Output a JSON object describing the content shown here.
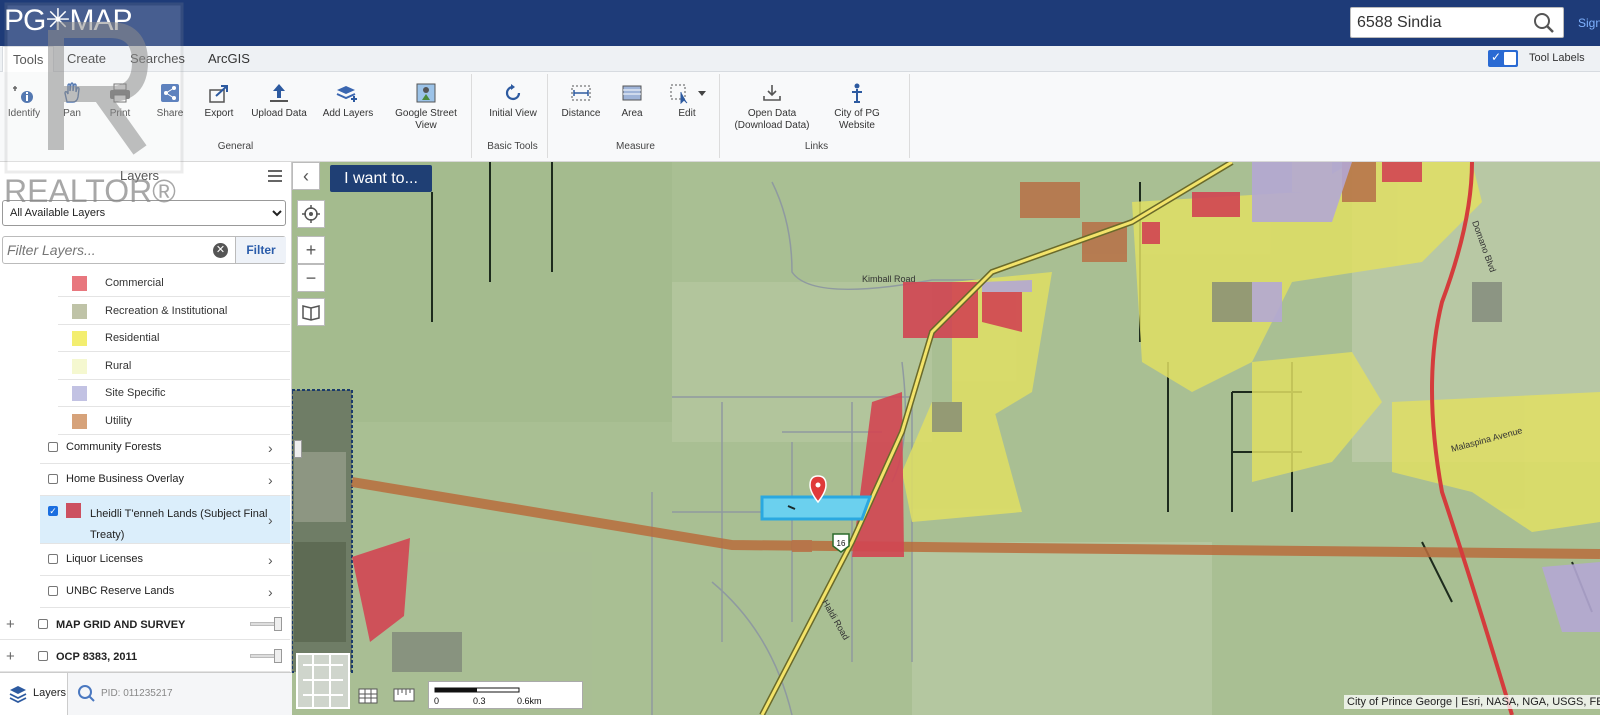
{
  "app": {
    "logo": "PG✳MAP",
    "search_value": "6588 Sindia",
    "sign_in": "Sign"
  },
  "tabs": [
    "Tools",
    "Create",
    "Searches",
    "ArcGIS"
  ],
  "tool_labels": "Tool Labels",
  "ribbon": {
    "general": {
      "label": "General",
      "tools": [
        "Identify",
        "Pan",
        "Print",
        "Share",
        "Export",
        "Upload Data",
        "Add Layers",
        "Google Street View"
      ]
    },
    "basic": {
      "label": "Basic Tools",
      "tools": [
        "Initial View"
      ]
    },
    "measure": {
      "label": "Measure",
      "tools": [
        "Distance",
        "Area",
        "Edit"
      ]
    },
    "links": {
      "label": "Links",
      "tools": [
        "Open Data (Download Data)",
        "City of PG Website"
      ]
    }
  },
  "panel": {
    "title": "Layers",
    "select_value": "All Available Layers",
    "filter_placeholder": "Filter Layers...",
    "filter_button": "Filter",
    "legend": [
      {
        "label": "Commercial",
        "color": "#e8777e"
      },
      {
        "label": "Recreation & Institutional",
        "color": "#bfc3a7"
      },
      {
        "label": "Residential",
        "color": "#f3ee70"
      },
      {
        "label": "Rural",
        "color": "#f5f8d0"
      },
      {
        "label": "Site Specific",
        "color": "#c2c2e3"
      },
      {
        "label": "Utility",
        "color": "#d6a27a"
      }
    ],
    "layers": [
      {
        "label": "Community Forests",
        "checked": false
      },
      {
        "label": "Home Business Overlay",
        "checked": false
      },
      {
        "label": "Lheidli T'enneh Lands (Subject Final Treaty)",
        "checked": true,
        "swatch": "#cc5060"
      },
      {
        "label": "Liquor Licenses",
        "checked": false
      },
      {
        "label": "UNBC Reserve Lands",
        "checked": false
      }
    ],
    "groups": [
      "MAP GRID AND SURVEY",
      "OCP 8383, 2011"
    ],
    "bottom_tab": "Layers",
    "pid": "PID: 011235217"
  },
  "map": {
    "iwant": "I want to...",
    "roads": [
      "Kimball Road",
      "Domano Blvd",
      "Malaspina Avenue",
      "Haldi Road"
    ],
    "highway": "16",
    "scale_ticks": [
      "0",
      "0.3",
      "0.6km"
    ],
    "attribution": "City of Prince George | Esri, NASA, NGA, USGS, FEMA"
  },
  "watermark": "REALTOR®"
}
